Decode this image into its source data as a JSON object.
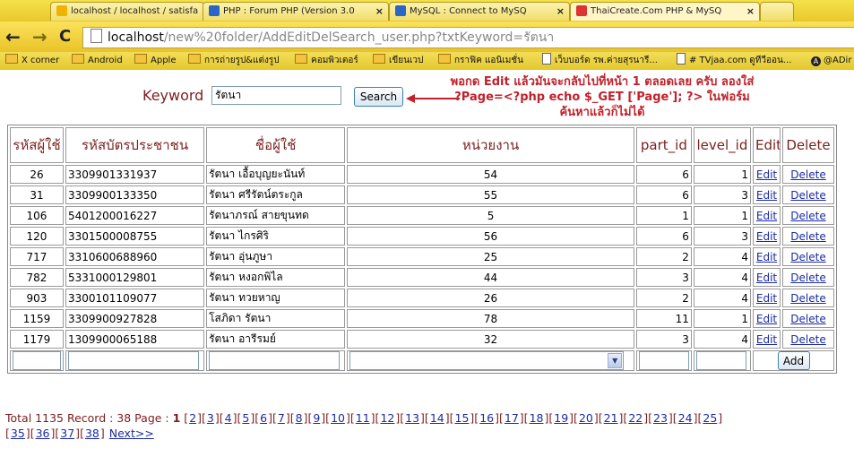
{
  "browser": {
    "tabs": [
      {
        "label": "localhost / localhost / satisfa",
        "icon": "phpmyadmin-icon"
      },
      {
        "label": "PHP : Forum PHP (Version 3.0",
        "icon": "thaicreate-icon"
      },
      {
        "label": "MySQL : Connect to MySQ",
        "icon": "thaicreate-icon"
      },
      {
        "label": "ThaiCreate.Com PHP & MySQ",
        "icon": "thaicreate-icon"
      }
    ],
    "url_host": "localhost",
    "url_path": "/new%20folder/AddEditDelSearch_user.php?txtKeyword=รัตนา",
    "bookmarks": [
      {
        "label": "X corner",
        "icon": "folder-icon"
      },
      {
        "label": "Android",
        "icon": "folder-icon"
      },
      {
        "label": "Apple",
        "icon": "folder-icon"
      },
      {
        "label": "การถ่ายรูป&แต่งรูป",
        "icon": "folder-icon"
      },
      {
        "label": "คอมพิวเตอร์",
        "icon": "folder-icon"
      },
      {
        "label": "เขียนเวป",
        "icon": "folder-icon"
      },
      {
        "label": "กราฟิค แอนิเมชั่น",
        "icon": "folder-icon"
      },
      {
        "label": "เว็บบอร์ด รพ.ค่ายสุรนารี...",
        "icon": "page-icon"
      },
      {
        "label": "# TVjaa.com ดูทีวีออน...",
        "icon": "page-icon"
      },
      {
        "label": "@ADir",
        "icon": "circle-icon"
      }
    ]
  },
  "search": {
    "label": "Keyword",
    "value": "รัตนา",
    "button": "Search"
  },
  "note": "พอกด Edit แล้วมันจะกลับไปที่หน้า 1 ตลอดเลย ครับ ลองใส่ ?Page=<?php echo $_GET ['Page']; ?> ในฟอร์มค้นหาแล้วก็ไม่ได้",
  "table": {
    "headers": [
      "รหัสผู้ใช้",
      "รหัสบัตรประชาชน",
      "ชื่อผู้ใช้",
      "หน่วยงาน",
      "part_id",
      "level_id",
      "Edit",
      "Delete"
    ],
    "rows": [
      {
        "id": "26",
        "card": "3309901331937",
        "name": "รัตนา เอื้อบุญยะนันท์",
        "unit": "54",
        "part": "6",
        "level": "1"
      },
      {
        "id": "31",
        "card": "3309900133350",
        "name": "รัตนา ศรีรัตน์ตระกูล",
        "unit": "55",
        "part": "6",
        "level": "3"
      },
      {
        "id": "106",
        "card": "5401200016227",
        "name": "รัตนาภรณ์ สายขุนทด",
        "unit": "5",
        "part": "1",
        "level": "1"
      },
      {
        "id": "120",
        "card": "3301500008755",
        "name": "รัตนา ไกรศิริ",
        "unit": "56",
        "part": "6",
        "level": "3"
      },
      {
        "id": "717",
        "card": "3310600688960",
        "name": "รัตนา อุ่นภูษา",
        "unit": "25",
        "part": "2",
        "level": "4"
      },
      {
        "id": "782",
        "card": "5331000129801",
        "name": "รัตนา หงอกพิไล",
        "unit": "44",
        "part": "3",
        "level": "4"
      },
      {
        "id": "903",
        "card": "3300101109077",
        "name": "รัตนา ทวยหาญ",
        "unit": "26",
        "part": "2",
        "level": "4"
      },
      {
        "id": "1159",
        "card": "3309900927828",
        "name": "โสภิดา รัตนา",
        "unit": "78",
        "part": "11",
        "level": "1"
      },
      {
        "id": "1179",
        "card": "1309900065188",
        "name": "รัตนา อารีรมย์",
        "unit": "32",
        "part": "3",
        "level": "4"
      }
    ],
    "edit_label": "Edit",
    "delete_label": "Delete",
    "add_label": "Add"
  },
  "pager": {
    "summary": "Total 1135 Record : 38 Page :",
    "current": "1",
    "pages_line1": [
      "2",
      "3",
      "4",
      "5",
      "6",
      "7",
      "8",
      "9",
      "10",
      "11",
      "12",
      "13",
      "14",
      "15",
      "16",
      "17",
      "18",
      "19",
      "20",
      "21",
      "22",
      "23",
      "24",
      "25"
    ],
    "pages_line2": [
      "35",
      "36",
      "37",
      "38"
    ],
    "next": "Next>>"
  }
}
